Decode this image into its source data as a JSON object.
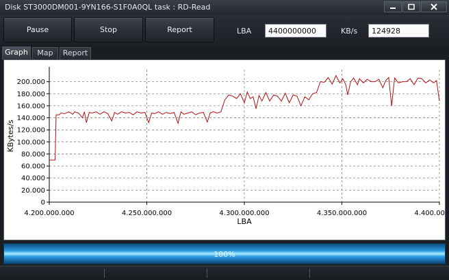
{
  "window": {
    "title": "Disk ST3000DM001-9YN166-S1F0A0QL   task : RD-Read",
    "controls": {
      "minimize": "minimize-icon",
      "maximize": "maximize-icon",
      "close": "close-icon"
    }
  },
  "toolbar": {
    "pause_label": "Pause",
    "stop_label": "Stop",
    "report_label": "Report",
    "lba_label": "LBA",
    "lba_value": "4400000000",
    "kbs_label": "KB/s",
    "kbs_value": "124928"
  },
  "tabs": [
    {
      "label": "Graph",
      "active": true
    },
    {
      "label": "Map",
      "active": false
    },
    {
      "label": "Report",
      "active": false
    }
  ],
  "colors": {
    "series": "#b01010",
    "grid": "#808080"
  },
  "chart_data": {
    "type": "line",
    "xlabel": "LBA",
    "ylabel": "KBytes/s",
    "xlim": [
      4200000000,
      4400000000
    ],
    "ylim": [
      0,
      220000
    ],
    "x_ticks": [
      "4.200.000.000",
      "4.250.000.000",
      "4.300.000.000",
      "4.350.000.000",
      "4.400.000.000"
    ],
    "y_ticks": [
      "0",
      "20.000",
      "40.000",
      "60.000",
      "80.000",
      "100.000",
      "120.000",
      "140.000",
      "160.000",
      "180.000",
      "200.000"
    ],
    "grid": true,
    "series": [
      {
        "points": [
          [
            4200000000,
            70000
          ],
          [
            4203000000,
            70000
          ],
          [
            4203500000,
            145000
          ],
          [
            4205000000,
            145000
          ],
          [
            4206000000,
            148000
          ],
          [
            4208000000,
            147000
          ],
          [
            4210000000,
            150000
          ],
          [
            4212000000,
            146000
          ],
          [
            4213000000,
            150000
          ],
          [
            4215000000,
            148000
          ],
          [
            4217000000,
            140000
          ],
          [
            4218000000,
            150000
          ],
          [
            4219000000,
            132000
          ],
          [
            4220500000,
            149000
          ],
          [
            4222000000,
            148000
          ],
          [
            4224000000,
            150000
          ],
          [
            4226000000,
            146000
          ],
          [
            4228000000,
            150000
          ],
          [
            4230000000,
            147000
          ],
          [
            4232000000,
            135000
          ],
          [
            4233500000,
            149000
          ],
          [
            4235000000,
            146000
          ],
          [
            4237000000,
            150000
          ],
          [
            4239000000,
            148000
          ],
          [
            4241000000,
            149000
          ],
          [
            4243000000,
            145000
          ],
          [
            4245000000,
            150000
          ],
          [
            4247000000,
            148000
          ],
          [
            4249000000,
            149000
          ],
          [
            4251000000,
            132000
          ],
          [
            4252500000,
            148000
          ],
          [
            4254000000,
            147000
          ],
          [
            4256000000,
            150000
          ],
          [
            4258000000,
            146000
          ],
          [
            4260000000,
            149000
          ],
          [
            4262000000,
            147000
          ],
          [
            4264000000,
            149000
          ],
          [
            4266000000,
            131000
          ],
          [
            4267500000,
            150000
          ],
          [
            4269000000,
            146000
          ],
          [
            4271000000,
            148000
          ],
          [
            4273000000,
            150000
          ],
          [
            4275000000,
            145000
          ],
          [
            4277000000,
            148000
          ],
          [
            4279000000,
            149000
          ],
          [
            4281000000,
            133000
          ],
          [
            4282500000,
            148000
          ],
          [
            4284000000,
            150000
          ],
          [
            4286000000,
            148000
          ],
          [
            4288000000,
            150000
          ],
          [
            4290000000,
            170000
          ],
          [
            4292000000,
            178000
          ],
          [
            4294000000,
            176000
          ],
          [
            4296000000,
            172000
          ],
          [
            4298000000,
            180000
          ],
          [
            4300000000,
            165000
          ],
          [
            4301500000,
            183000
          ],
          [
            4303000000,
            172000
          ],
          [
            4304500000,
            175000
          ],
          [
            4306000000,
            155000
          ],
          [
            4307500000,
            177000
          ],
          [
            4309000000,
            168000
          ],
          [
            4311000000,
            182000
          ],
          [
            4313000000,
            168000
          ],
          [
            4315000000,
            178000
          ],
          [
            4317000000,
            176000
          ],
          [
            4319000000,
            168000
          ],
          [
            4321000000,
            181000
          ],
          [
            4323000000,
            165000
          ],
          [
            4325000000,
            178000
          ],
          [
            4327000000,
            176000
          ],
          [
            4329000000,
            160000
          ],
          [
            4331000000,
            175000
          ],
          [
            4333000000,
            170000
          ],
          [
            4335000000,
            180000
          ],
          [
            4337000000,
            182000
          ],
          [
            4339000000,
            200000
          ],
          [
            4341000000,
            199000
          ],
          [
            4343000000,
            207000
          ],
          [
            4345000000,
            196000
          ],
          [
            4347000000,
            210000
          ],
          [
            4349000000,
            198000
          ],
          [
            4350500000,
            205000
          ],
          [
            4352000000,
            195000
          ],
          [
            4353000000,
            178000
          ],
          [
            4354500000,
            200000
          ],
          [
            4356000000,
            206000
          ],
          [
            4358000000,
            195000
          ],
          [
            4359000000,
            205000
          ],
          [
            4361000000,
            198000
          ],
          [
            4363000000,
            204000
          ],
          [
            4365000000,
            200000
          ],
          [
            4367000000,
            200000
          ],
          [
            4369000000,
            204000
          ],
          [
            4371000000,
            190000
          ],
          [
            4372500000,
            202000
          ],
          [
            4374000000,
            207000
          ],
          [
            4375500000,
            160000
          ],
          [
            4377000000,
            206000
          ],
          [
            4379000000,
            198000
          ],
          [
            4381000000,
            200000
          ],
          [
            4383000000,
            200000
          ],
          [
            4385000000,
            205000
          ],
          [
            4387000000,
            195000
          ],
          [
            4389000000,
            206000
          ],
          [
            4391000000,
            205000
          ],
          [
            4393000000,
            198000
          ],
          [
            4395000000,
            203000
          ],
          [
            4397000000,
            198000
          ],
          [
            4398500000,
            202000
          ],
          [
            4400000000,
            168000
          ]
        ]
      }
    ]
  },
  "progress": {
    "label": "100%",
    "fraction": 1.0
  }
}
